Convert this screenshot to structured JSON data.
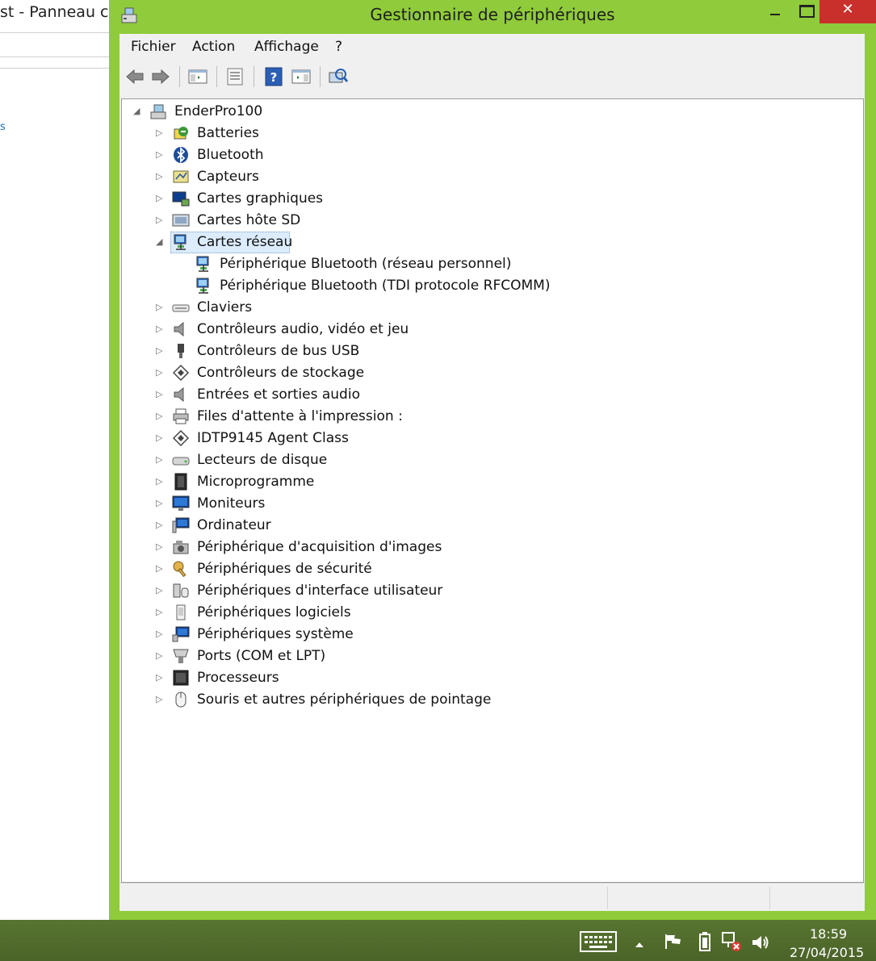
{
  "background_window": {
    "title": "st - Panneau c",
    "fragment": "s"
  },
  "window": {
    "title": "Gestionnaire de périphériques",
    "close_glyph": "✕"
  },
  "menu": {
    "items": [
      "Fichier",
      "Action",
      "Affichage",
      "?"
    ]
  },
  "toolbar": {
    "buttons": [
      "back-arrow-icon",
      "forward-arrow-icon",
      "show-hide-console-tree-icon",
      "properties-icon",
      "help-icon",
      "action-pane-icon",
      "scan-hardware-icon"
    ]
  },
  "tree": {
    "root": "EnderPro100",
    "categories": [
      {
        "label": "Batteries",
        "icon": "battery-icon",
        "expanded": false
      },
      {
        "label": "Bluetooth",
        "icon": "bluetooth-icon",
        "expanded": false
      },
      {
        "label": "Capteurs",
        "icon": "sensor-icon",
        "expanded": false
      },
      {
        "label": "Cartes graphiques",
        "icon": "display-adapter-icon",
        "expanded": false
      },
      {
        "label": "Cartes hôte SD",
        "icon": "sd-host-icon",
        "expanded": false
      },
      {
        "label": "Cartes réseau",
        "icon": "network-adapter-icon",
        "expanded": true,
        "selected": true,
        "children": [
          "Périphérique Bluetooth (réseau personnel)",
          "Périphérique Bluetooth (TDI protocole RFCOMM)"
        ]
      },
      {
        "label": "Claviers",
        "icon": "keyboard-icon",
        "expanded": false
      },
      {
        "label": "Contrôleurs audio, vidéo et jeu",
        "icon": "speaker-icon",
        "expanded": false
      },
      {
        "label": "Contrôleurs de bus USB",
        "icon": "usb-icon",
        "expanded": false
      },
      {
        "label": "Contrôleurs de stockage",
        "icon": "storage-controller-icon",
        "expanded": false
      },
      {
        "label": "Entrées et sorties audio",
        "icon": "audio-io-icon",
        "expanded": false
      },
      {
        "label": "Files d'attente à l'impression :",
        "icon": "printer-icon",
        "expanded": false
      },
      {
        "label": "IDTP9145 Agent Class",
        "icon": "agent-class-icon",
        "expanded": false
      },
      {
        "label": "Lecteurs de disque",
        "icon": "disk-drive-icon",
        "expanded": false
      },
      {
        "label": "Microprogramme",
        "icon": "firmware-icon",
        "expanded": false
      },
      {
        "label": "Moniteurs",
        "icon": "monitor-icon",
        "expanded": false
      },
      {
        "label": "Ordinateur",
        "icon": "computer-icon",
        "expanded": false
      },
      {
        "label": "Périphérique d'acquisition d'images",
        "icon": "camera-icon",
        "expanded": false
      },
      {
        "label": "Périphériques de sécurité",
        "icon": "key-icon",
        "expanded": false
      },
      {
        "label": "Périphériques d'interface utilisateur",
        "icon": "hid-icon",
        "expanded": false
      },
      {
        "label": "Périphériques logiciels",
        "icon": "software-device-icon",
        "expanded": false
      },
      {
        "label": "Périphériques système",
        "icon": "system-device-icon",
        "expanded": false
      },
      {
        "label": "Ports (COM et LPT)",
        "icon": "port-icon",
        "expanded": false
      },
      {
        "label": "Processeurs",
        "icon": "processor-icon",
        "expanded": false
      },
      {
        "label": "Souris et autres périphériques de pointage",
        "icon": "mouse-icon",
        "expanded": false
      }
    ]
  },
  "taskbar": {
    "tray_icons": [
      "touch-keyboard-icon",
      "show-hidden-icons-icon",
      "action-center-flag-icon",
      "battery-icon",
      "network-disconnected-icon",
      "volume-icon"
    ],
    "time": "18:59",
    "date": "27/04/2015"
  },
  "colors": {
    "window_frame": "#8fcb3a",
    "close_button": "#c9302c",
    "taskbar": "#4f6a2c",
    "selection": "#dcecfc"
  }
}
